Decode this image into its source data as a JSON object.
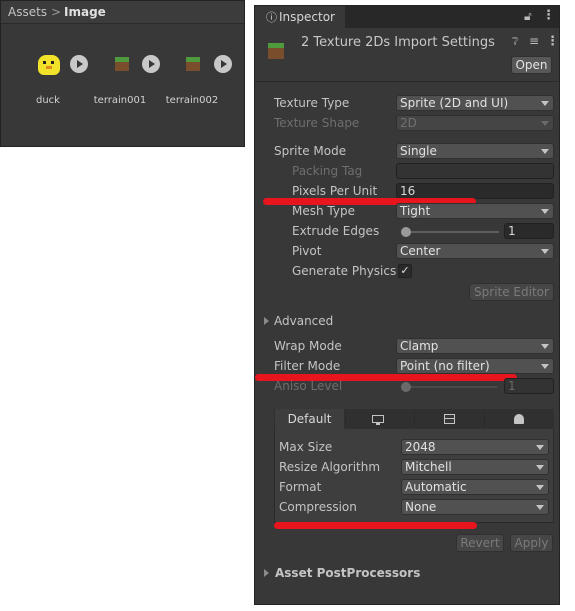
{
  "project": {
    "breadcrumb": [
      "Assets",
      "Image"
    ],
    "assets": [
      {
        "name": "duck",
        "icon": "duck-sprite-icon"
      },
      {
        "name": "terrain001",
        "icon": "terrain-sprite-icon"
      },
      {
        "name": "terrain002",
        "icon": "terrain-sprite-icon"
      }
    ]
  },
  "inspector": {
    "tab_label": "Inspector",
    "title": "2 Texture 2Ds Import Settings",
    "open_label": "Open",
    "fields": {
      "texture_type": {
        "label": "Texture Type",
        "value": "Sprite (2D and UI)"
      },
      "texture_shape": {
        "label": "Texture Shape",
        "value": "2D"
      },
      "sprite_mode": {
        "label": "Sprite Mode",
        "value": "Single"
      },
      "packing_tag": {
        "label": "Packing Tag",
        "value": ""
      },
      "pixels_per_unit": {
        "label": "Pixels Per Unit",
        "value": "16"
      },
      "mesh_type": {
        "label": "Mesh Type",
        "value": "Tight"
      },
      "extrude_edges": {
        "label": "Extrude Edges",
        "value": "1"
      },
      "pivot": {
        "label": "Pivot",
        "value": "Center"
      },
      "generate_physics": {
        "label": "Generate Physics",
        "checked": true
      },
      "wrap_mode": {
        "label": "Wrap Mode",
        "value": "Clamp"
      },
      "filter_mode": {
        "label": "Filter Mode",
        "value": "Point (no filter)"
      },
      "aniso_level": {
        "label": "Aniso Level",
        "value": "1"
      }
    },
    "sprite_editor_label": "Sprite Editor",
    "advanced_label": "Advanced",
    "platform": {
      "default_tab": "Default",
      "tab_icons": [
        "monitor-icon",
        "server-icon",
        "android-icon"
      ],
      "max_size": {
        "label": "Max Size",
        "value": "2048"
      },
      "resize_algorithm": {
        "label": "Resize Algorithm",
        "value": "Mitchell"
      },
      "format": {
        "label": "Format",
        "value": "Automatic"
      },
      "compression": {
        "label": "Compression",
        "value": "None"
      }
    },
    "revert_label": "Revert",
    "apply_label": "Apply",
    "postprocessors_label": "Asset PostProcessors"
  },
  "colors": {
    "panel_bg": "#383838",
    "annotation_red": "#e8141e"
  }
}
